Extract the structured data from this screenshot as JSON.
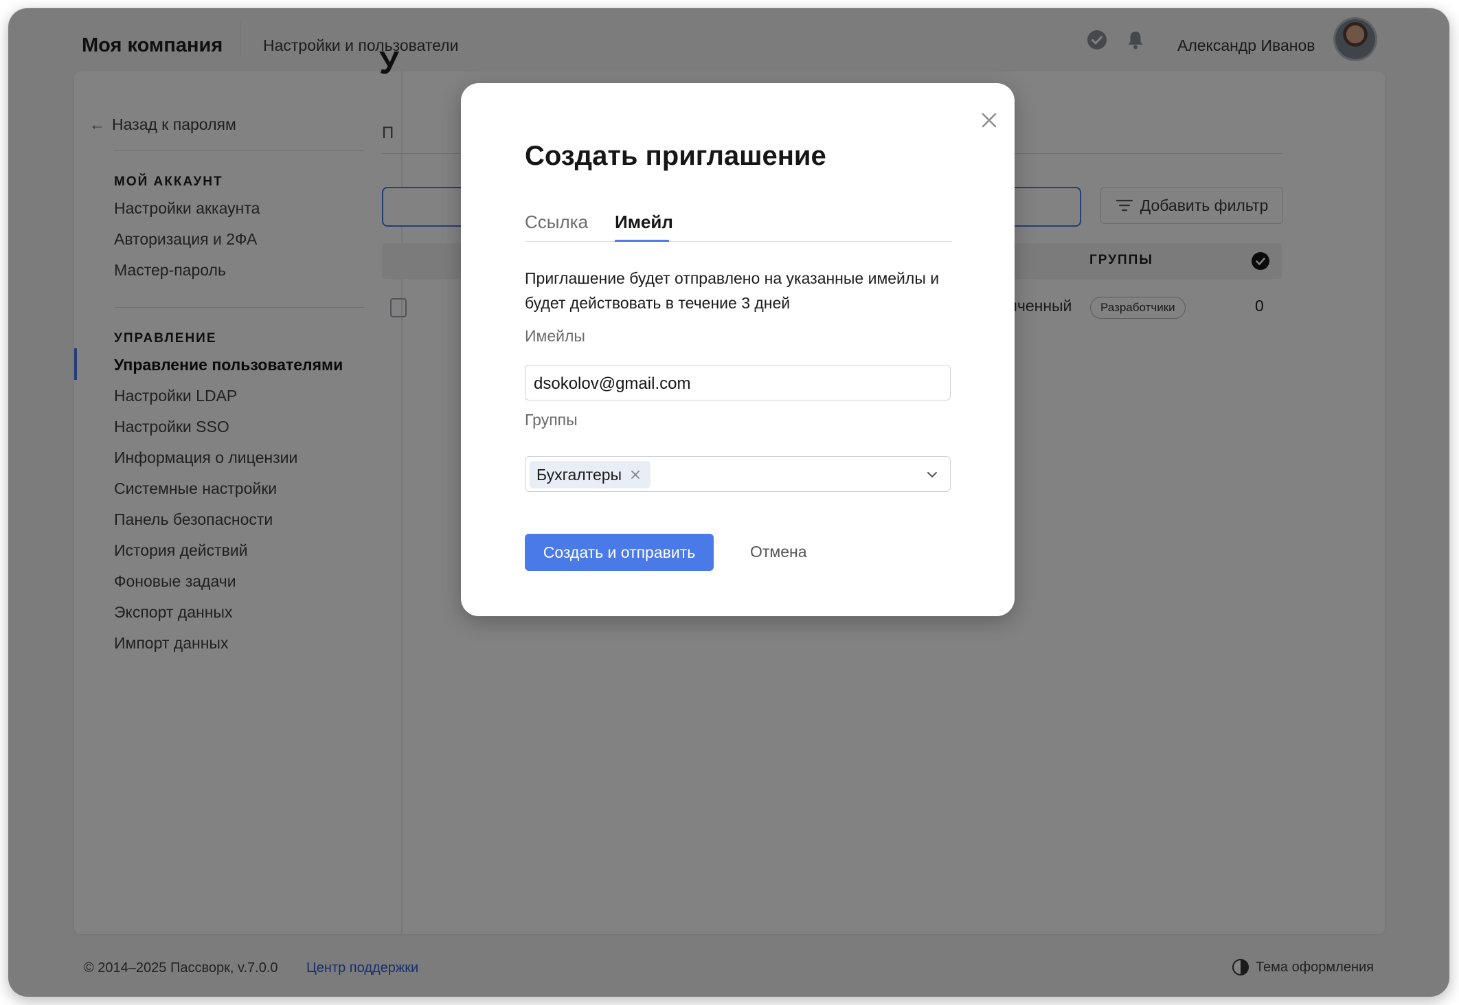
{
  "header": {
    "brand": "Моя компания",
    "section": "Настройки и пользователи",
    "user_name": "Александр Иванов",
    "icons": [
      "check-circle-icon",
      "bell-icon"
    ]
  },
  "sidebar": {
    "back_label": "Назад к паролям",
    "account_heading": "МОЙ АККАУНТ",
    "account_items": [
      "Настройки аккаунта",
      "Авторизация и 2ФА",
      "Мастер-пароль"
    ],
    "admin_heading": "УПРАВЛЕНИЕ",
    "admin_items": [
      "Управление пользователями",
      "Настройки LDAP",
      "Настройки SSO",
      "Информация о лицензии",
      "Системные настройки",
      "Панель безопасности",
      "История действий",
      "Фоновые задачи",
      "Экспорт данных",
      "Импорт данных"
    ],
    "active_item": "Управление пользователями"
  },
  "content": {
    "title_partial": "У",
    "tab_partial": "П",
    "filter_button": "Добавить фильтр",
    "table": {
      "groups_header": "ГРУППЫ",
      "row": {
        "role_partial": "иченный",
        "group_badge": "Разработчики",
        "count": "0"
      }
    }
  },
  "modal": {
    "title": "Создать приглашение",
    "tabs": [
      "Ссылка",
      "Имейл"
    ],
    "active_tab": "Имейл",
    "description": "Приглашение будет отправлено на указанные имейлы и будет действовать в течение 3 дней",
    "emails_label": "Имейлы",
    "emails_value": "dsokolov@gmail.com",
    "groups_label": "Группы",
    "groups_selected": [
      "Бухгалтеры"
    ],
    "submit_label": "Создать и отправить",
    "cancel_label": "Отмена"
  },
  "footer": {
    "copyright": "© 2014–2025 Пассворк, v.7.0.0",
    "support_link": "Центр поддержки",
    "theme_label": "Тема оформления"
  },
  "colors": {
    "accent": "#4a79e8",
    "link": "#2c5bd6",
    "overlay": "rgba(0,0,0,0.49)"
  }
}
